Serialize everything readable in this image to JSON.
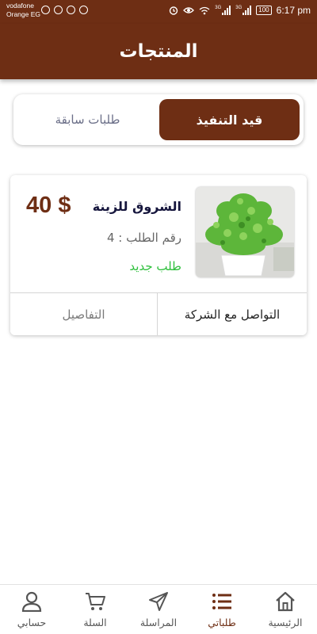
{
  "status_bar": {
    "carrier_line1": "vodafone",
    "carrier_line2": "Orange EG",
    "network1": "3G",
    "network2": "3G",
    "battery": "100",
    "time": "6:17 pm"
  },
  "header": {
    "title": "المنتجات"
  },
  "tabs": {
    "active": "قيد التنفيذ",
    "inactive": "طلبات سابقة"
  },
  "order": {
    "company": "الشروق للزينة",
    "price": "40 $",
    "order_number": "رقم الطلب : 4",
    "status": "طلب جديد",
    "contact_button": "التواصل مع الشركة",
    "details_button": "التفاصيل"
  },
  "bottom_nav": {
    "home": "الرئيسية",
    "orders": "طلباتي",
    "messages": "المراسلة",
    "cart": "السلة",
    "account": "حسابي"
  },
  "colors": {
    "primary": "#6e2e14",
    "status_green": "#2ec03c",
    "company_name": "#16163d"
  },
  "icons": [
    "home-icon",
    "list-icon",
    "send-icon",
    "cart-icon",
    "user-icon",
    "alarm-icon",
    "eye-icon",
    "wifi-icon",
    "signal-icon",
    "battery-icon"
  ]
}
